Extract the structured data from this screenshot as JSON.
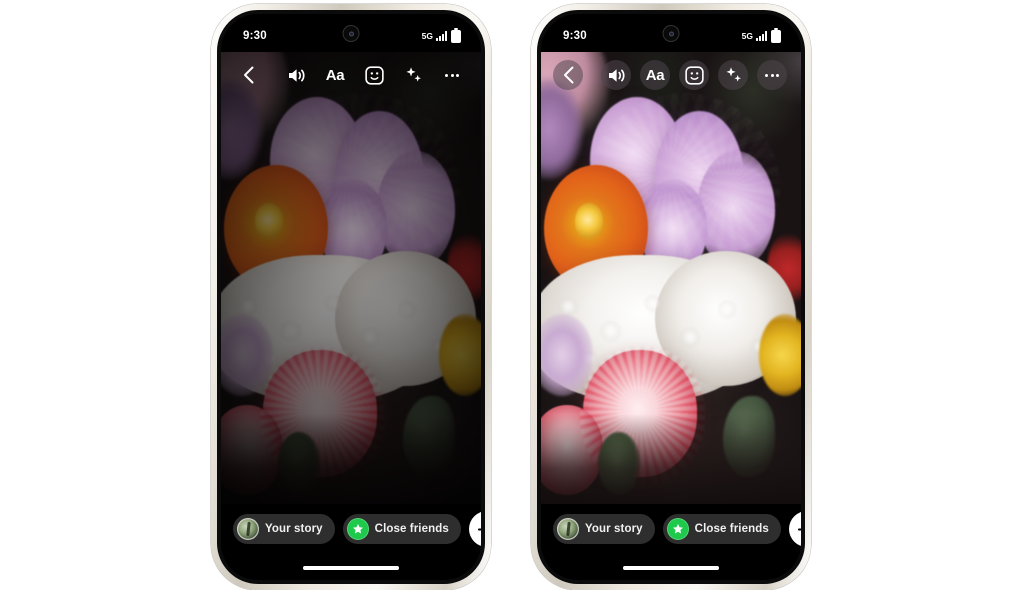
{
  "page": {
    "background_color": "#ffffff",
    "description": "Two smartphone mockups side by side showing an Instagram story composer with a flower bouquet photo"
  },
  "phones": [
    {
      "id": "left",
      "frame_color": "#e8e3d9",
      "screen_bg": "#000000",
      "image_appearance": "dimmed",
      "toolbar_icon_chips": false,
      "status_bar": {
        "time": "9:30",
        "network": "5G",
        "signal_icon": "signal-bars-icon",
        "battery_icon": "battery-full-icon"
      },
      "top_toolbar": {
        "back": {
          "label": "",
          "icon": "chevron-left-icon"
        },
        "actions": [
          {
            "name": "volume",
            "icon": "speaker-volume-icon",
            "label": ""
          },
          {
            "name": "text",
            "icon": "text-aa-icon",
            "label": "Aa"
          },
          {
            "name": "sticker",
            "icon": "sticker-smiley-icon",
            "label": ""
          },
          {
            "name": "effects",
            "icon": "sparkles-icon",
            "label": ""
          },
          {
            "name": "more",
            "icon": "more-horizontal-icon",
            "label": ""
          }
        ]
      },
      "bottom_bar": {
        "your_story": {
          "label": "Your story",
          "icon": "avatar-icon"
        },
        "close_friends": {
          "label": "Close friends",
          "icon": "green-star-icon",
          "badge_color": "#1ec94b"
        },
        "send": {
          "label": "",
          "icon": "arrow-right-icon"
        }
      }
    },
    {
      "id": "right",
      "frame_color": "#e8e3d9",
      "screen_bg": "#000000",
      "image_appearance": "bright",
      "toolbar_icon_chips": true,
      "status_bar": {
        "time": "9:30",
        "network": "5G",
        "signal_icon": "signal-bars-icon",
        "battery_icon": "battery-full-icon"
      },
      "top_toolbar": {
        "back": {
          "label": "",
          "icon": "chevron-left-icon"
        },
        "actions": [
          {
            "name": "volume",
            "icon": "speaker-volume-icon",
            "label": ""
          },
          {
            "name": "text",
            "icon": "text-aa-icon",
            "label": "Aa"
          },
          {
            "name": "sticker",
            "icon": "sticker-smiley-icon",
            "label": ""
          },
          {
            "name": "effects",
            "icon": "sparkles-icon",
            "label": ""
          },
          {
            "name": "more",
            "icon": "more-horizontal-icon",
            "label": ""
          }
        ]
      },
      "bottom_bar": {
        "your_story": {
          "label": "Your story",
          "icon": "avatar-icon"
        },
        "close_friends": {
          "label": "Close friends",
          "icon": "green-star-icon",
          "badge_color": "#1ec94b"
        },
        "send": {
          "label": "",
          "icon": "arrow-right-icon"
        }
      }
    }
  ],
  "colors": {
    "accent_green": "#1ec94b",
    "pill_bg": "#2e2e2e",
    "send_bg": "#ffffff",
    "bar_bg": "#000000",
    "text": "#f0f0f0"
  }
}
